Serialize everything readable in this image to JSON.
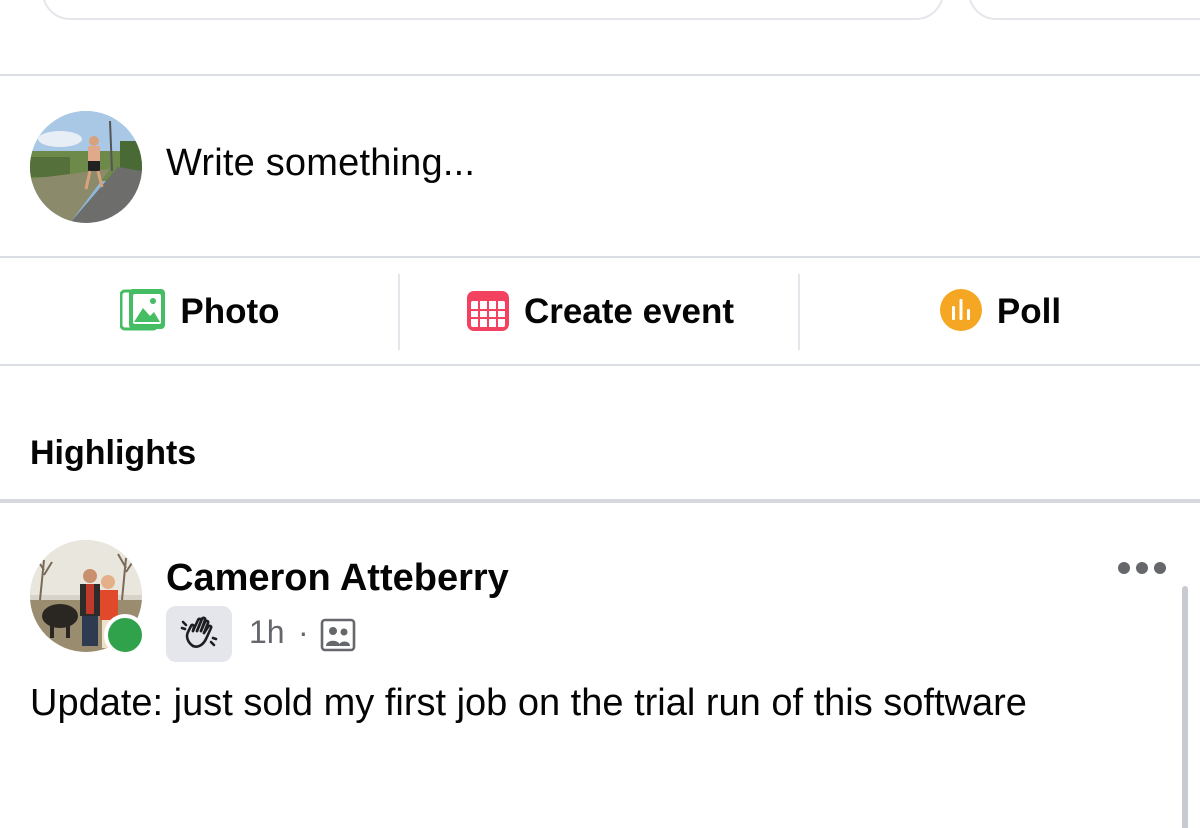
{
  "composer": {
    "placeholder": "Write something...",
    "avatar_icon": "profile-photo-runner"
  },
  "actions": [
    {
      "label": "Photo",
      "icon": "photo-icon",
      "color": "#45bd62"
    },
    {
      "label": "Create event",
      "icon": "calendar-icon",
      "color": "#f3425f"
    },
    {
      "label": "Poll",
      "icon": "poll-icon",
      "color": "#f7b928"
    }
  ],
  "highlights": {
    "title": "Highlights"
  },
  "post": {
    "author": "Cameron Atteberry",
    "badge_icon": "wave-icon",
    "time": "1h",
    "separator": "·",
    "audience_icon": "group-members-icon",
    "online": true,
    "online_color": "#31a24c",
    "text": "Update: just sold my first job on the trial run of this software"
  }
}
